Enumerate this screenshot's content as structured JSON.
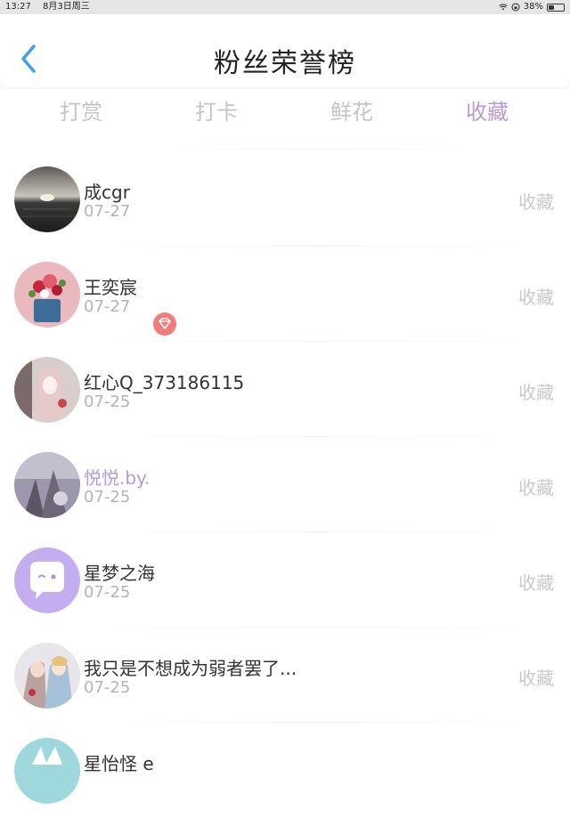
{
  "status_bar": {
    "time": "13:27",
    "date": "8月3日周三",
    "battery": "38%",
    "battery_level": 0.38,
    "icons": [
      "wifi-icon",
      "orientation-lock-icon",
      "battery-icon"
    ]
  },
  "header": {
    "title": "粉丝荣誉榜",
    "back_icon": "chevron-left-icon",
    "accent_color": "#3ea1f0"
  },
  "tabs": [
    {
      "label": "打赏",
      "active": false
    },
    {
      "label": "打卡",
      "active": false
    },
    {
      "label": "鲜花",
      "active": false
    },
    {
      "label": "收藏",
      "active": true
    }
  ],
  "colors": {
    "active_tab": "#b99ad6",
    "inactive_tab": "#c4c4c4",
    "vip_name": "#b99ad6",
    "vip_badge": "#f07c7c"
  },
  "fans": [
    {
      "name": "成cgr",
      "date": "07-27",
      "action": "收藏",
      "avatar": "sunset-sea-avatar"
    },
    {
      "name": "王奕宸",
      "date": "07-27",
      "action": "收藏",
      "avatar": "flowers-mug-avatar"
    },
    {
      "name": "红心Q_373186115",
      "date": "07-25",
      "action": "收藏",
      "avatar": "anime-girl-avatar"
    },
    {
      "name": "悦悦.by.",
      "date": "07-25",
      "action": "收藏",
      "avatar": "dark-scene-avatar",
      "vip": true,
      "badge_icon": "diamond-badge-icon"
    },
    {
      "name": "星梦之海",
      "date": "07-25",
      "action": "收藏",
      "avatar": "chat-bubble-avatar"
    },
    {
      "name": "我只是不想成为弱者罢了...",
      "date": "07-25",
      "action": "收藏",
      "avatar": "anime-couple-avatar"
    },
    {
      "name": "星怡怪 e",
      "date": "",
      "action": "",
      "avatar": "partial-avatar"
    }
  ]
}
